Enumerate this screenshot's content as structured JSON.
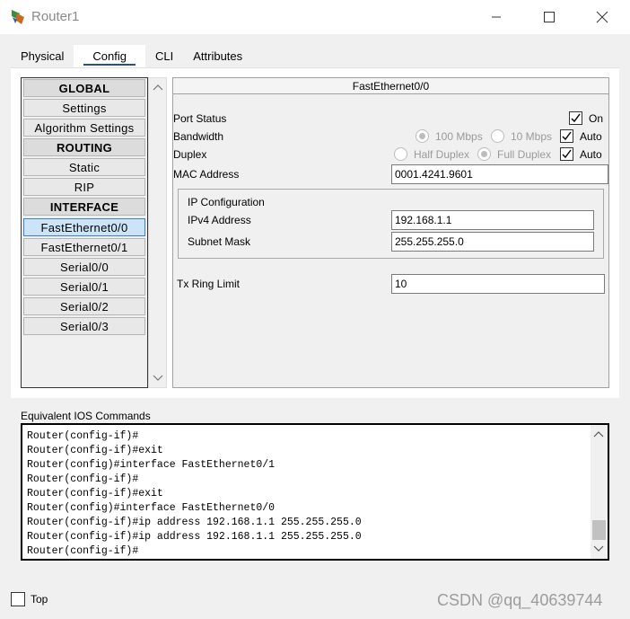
{
  "window": {
    "title": "Router1"
  },
  "tabs": [
    "Physical",
    "Config",
    "CLI",
    "Attributes"
  ],
  "nav": {
    "items": [
      {
        "label": "GLOBAL",
        "header": true
      },
      {
        "label": "Settings"
      },
      {
        "label": "Algorithm Settings"
      },
      {
        "label": "ROUTING",
        "header": true
      },
      {
        "label": "Static"
      },
      {
        "label": "RIP"
      },
      {
        "label": "INTERFACE",
        "header": true
      },
      {
        "label": "FastEthernet0/0",
        "selected": true
      },
      {
        "label": "FastEthernet0/1"
      },
      {
        "label": "Serial0/0"
      },
      {
        "label": "Serial0/1"
      },
      {
        "label": "Serial0/2"
      },
      {
        "label": "Serial0/3"
      }
    ]
  },
  "interface": {
    "title": "FastEthernet0/0",
    "port_status_label": "Port Status",
    "port_status_on_label": "On",
    "bandwidth_label": "Bandwidth",
    "bw_100": "100 Mbps",
    "bw_10": "10 Mbps",
    "bw_auto": "Auto",
    "duplex_label": "Duplex",
    "half_duplex": "Half Duplex",
    "full_duplex": "Full Duplex",
    "duplex_auto": "Auto",
    "mac_label": "MAC Address",
    "mac_value": "0001.4241.9601",
    "ip_config_label": "IP Configuration",
    "ipv4_label": "IPv4 Address",
    "ipv4_value": "192.168.1.1",
    "subnet_label": "Subnet Mask",
    "subnet_value": "255.255.255.0",
    "tx_label": "Tx Ring Limit",
    "tx_value": "10"
  },
  "ios": {
    "label": "Equivalent IOS Commands",
    "lines": [
      "Router(config-if)#",
      "Router(config-if)#exit",
      "Router(config)#interface FastEthernet0/1",
      "Router(config-if)#",
      "Router(config-if)#exit",
      "Router(config)#interface FastEthernet0/0",
      "Router(config-if)#ip address 192.168.1.1 255.255.255.0",
      "Router(config-if)#ip address 192.168.1.1 255.255.255.0",
      "Router(config-if)#"
    ]
  },
  "footer": {
    "top_label": "Top",
    "watermark": "CSDN @qq_40639744"
  },
  "colors": {
    "selected_bg": "#cce4f7",
    "accent": "#2a4d8f"
  }
}
